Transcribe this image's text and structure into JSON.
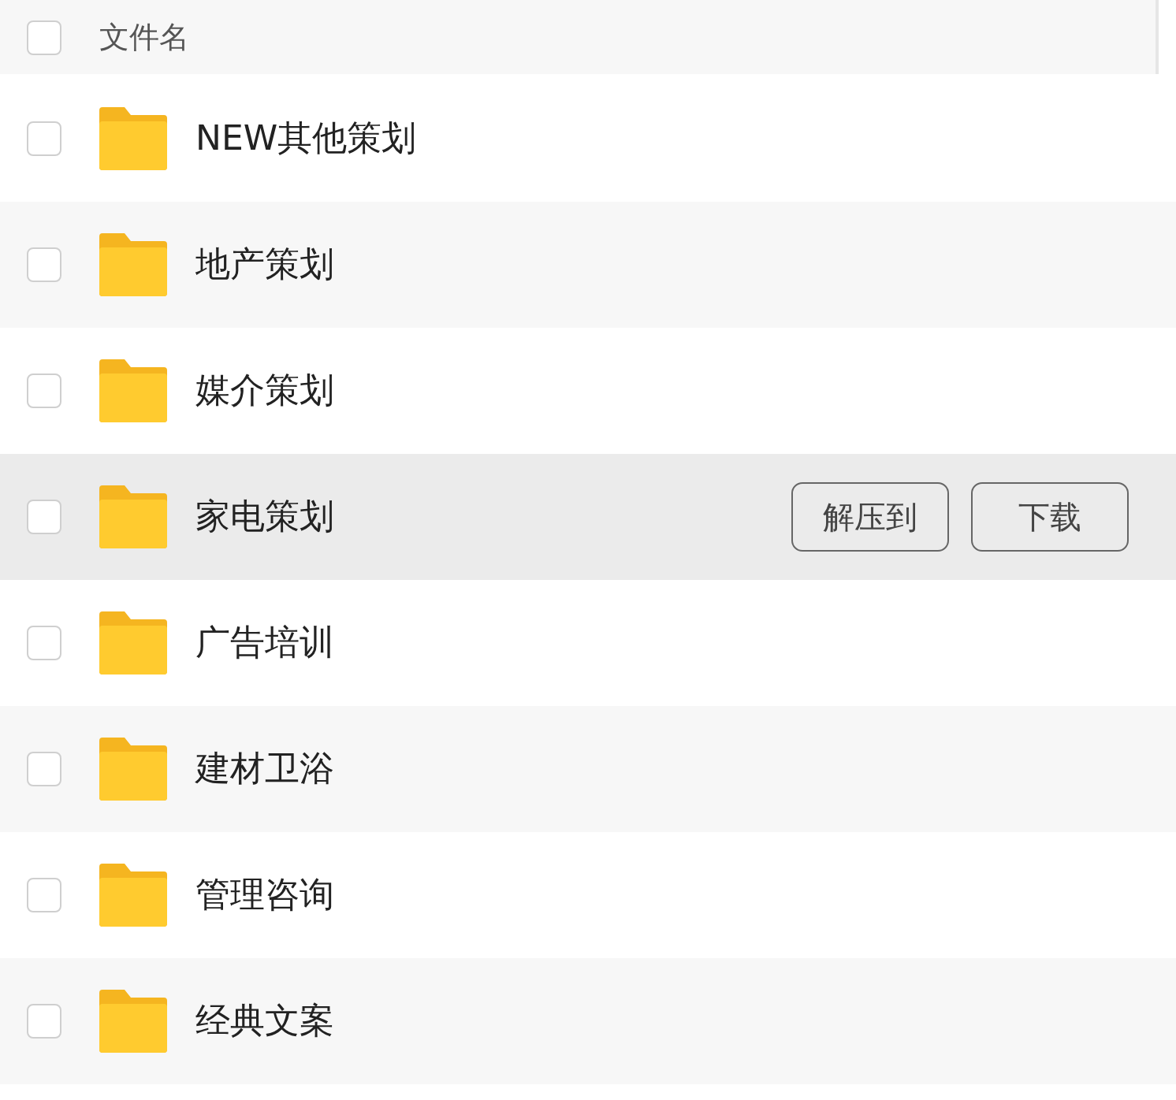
{
  "header": {
    "checked": false,
    "column_title": "文件名"
  },
  "rows": [
    {
      "name": "NEW其他策划",
      "checked": false,
      "hovered": false
    },
    {
      "name": "地产策划",
      "checked": false,
      "hovered": false
    },
    {
      "name": "媒介策划",
      "checked": false,
      "hovered": false
    },
    {
      "name": "家电策划",
      "checked": false,
      "hovered": true,
      "actions": [
        "解压到",
        "下载"
      ]
    },
    {
      "name": "广告培训",
      "checked": false,
      "hovered": false
    },
    {
      "name": "建材卫浴",
      "checked": false,
      "hovered": false
    },
    {
      "name": "管理咨询",
      "checked": false,
      "hovered": false
    },
    {
      "name": "经典文案",
      "checked": false,
      "hovered": false
    }
  ]
}
